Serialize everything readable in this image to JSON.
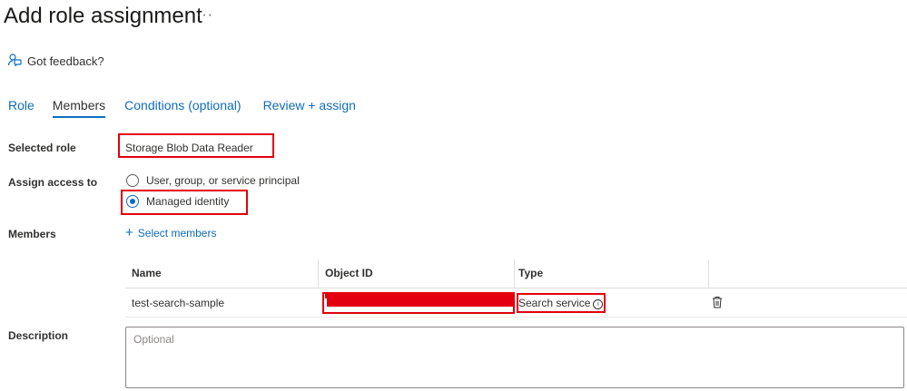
{
  "header": {
    "title": "Add role assignment",
    "more": "···"
  },
  "feedback": {
    "label": "Got feedback?"
  },
  "tabs": [
    {
      "label": "Role"
    },
    {
      "label": "Members",
      "active": true
    },
    {
      "label": "Conditions (optional)"
    },
    {
      "label": "Review + assign"
    }
  ],
  "form": {
    "selected_role_label": "Selected role",
    "selected_role_value": "Storage Blob Data Reader",
    "assign_access_label": "Assign access to",
    "assign_options": [
      {
        "label": "User, group, or service principal",
        "checked": false
      },
      {
        "label": "Managed identity",
        "checked": true
      }
    ],
    "members_label": "Members",
    "select_members": "Select members",
    "description_label": "Description",
    "description_placeholder": "Optional"
  },
  "members_table": {
    "columns": [
      "Name",
      "Object ID",
      "Type"
    ],
    "rows": [
      {
        "name": "test-search-sample",
        "type": "Search service"
      }
    ]
  },
  "colors": {
    "accent": "#0f6cbd",
    "highlight": "#e3000f",
    "text": "#323130"
  }
}
